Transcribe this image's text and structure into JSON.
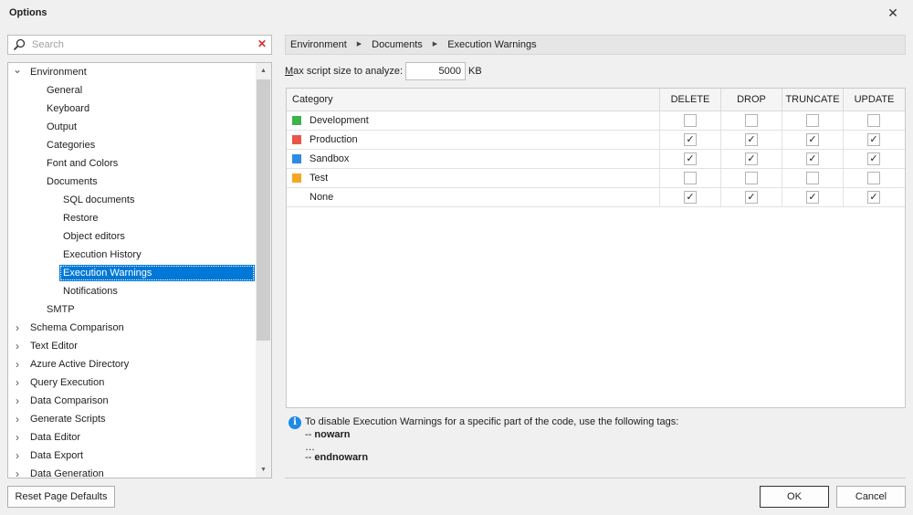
{
  "dialog": {
    "title": "Options",
    "close_glyph": "✕"
  },
  "search": {
    "placeholder": "Search",
    "clear_glyph": "✕"
  },
  "tree": {
    "items": [
      {
        "label": "Environment",
        "level": 0,
        "expanded": true
      },
      {
        "label": "General",
        "level": 1
      },
      {
        "label": "Keyboard",
        "level": 1
      },
      {
        "label": "Output",
        "level": 1
      },
      {
        "label": "Categories",
        "level": 1
      },
      {
        "label": "Font and Colors",
        "level": 1
      },
      {
        "label": "Documents",
        "level": 1,
        "expanded": true
      },
      {
        "label": "SQL documents",
        "level": 2
      },
      {
        "label": "Restore",
        "level": 2
      },
      {
        "label": "Object editors",
        "level": 2
      },
      {
        "label": "Execution History",
        "level": 2
      },
      {
        "label": "Execution Warnings",
        "level": 2,
        "selected": true
      },
      {
        "label": "Notifications",
        "level": 2
      },
      {
        "label": "SMTP",
        "level": 1
      },
      {
        "label": "Schema Comparison",
        "level": 0,
        "expanded": false
      },
      {
        "label": "Text Editor",
        "level": 0,
        "expanded": false
      },
      {
        "label": "Azure Active Directory",
        "level": 0,
        "expanded": false
      },
      {
        "label": "Query Execution",
        "level": 0,
        "expanded": false
      },
      {
        "label": "Data Comparison",
        "level": 0,
        "expanded": false
      },
      {
        "label": "Generate Scripts",
        "level": 0,
        "expanded": false
      },
      {
        "label": "Data Editor",
        "level": 0,
        "expanded": false
      },
      {
        "label": "Data Export",
        "level": 0,
        "expanded": false
      },
      {
        "label": "Data Generation",
        "level": 0,
        "expanded": false
      }
    ]
  },
  "breadcrumb": [
    "Environment",
    "Documents",
    "Execution Warnings"
  ],
  "max_script": {
    "label_underlined": "M",
    "label_rest": "ax script size to analyze:",
    "value": "5000",
    "unit": "KB"
  },
  "grid": {
    "columns": [
      "Category",
      "DELETE",
      "DROP",
      "TRUNCATE",
      "UPDATE"
    ],
    "rows": [
      {
        "name": "Development",
        "color": "#3cb44b",
        "checks": [
          false,
          false,
          false,
          false
        ]
      },
      {
        "name": "Production",
        "color": "#e8574a",
        "checks": [
          true,
          true,
          true,
          true
        ]
      },
      {
        "name": "Sandbox",
        "color": "#2b8be6",
        "checks": [
          true,
          true,
          true,
          true
        ]
      },
      {
        "name": "Test",
        "color": "#f5a623",
        "checks": [
          false,
          false,
          false,
          false
        ]
      },
      {
        "name": "None",
        "color": null,
        "checks": [
          true,
          true,
          true,
          true
        ]
      }
    ]
  },
  "info": {
    "text": "To disable Execution Warnings for a specific part of the code, use the following tags:",
    "tag_start_prefix": "-- ",
    "tag_start": "nowarn",
    "ellipsis": "…",
    "tag_end_prefix": "-- ",
    "tag_end": "endnowarn"
  },
  "buttons": {
    "reset": "Reset Page Defaults",
    "ok": "OK",
    "cancel": "Cancel"
  }
}
